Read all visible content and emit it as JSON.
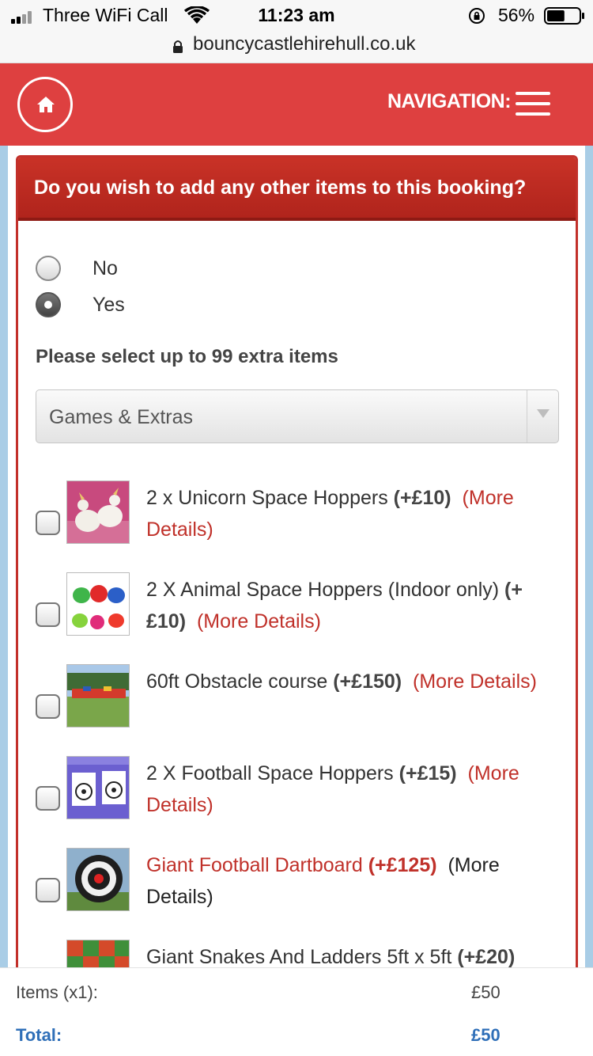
{
  "status_bar": {
    "carrier": "Three WiFi Call",
    "time": "11:23 am",
    "battery": "56%",
    "battery_level": 0.56,
    "icons": [
      "signal-icon",
      "wifi-icon",
      "orientation-lock-icon",
      "battery-icon"
    ]
  },
  "browser": {
    "url": "bouncycastlehirehull.co.uk"
  },
  "header": {
    "nav_label": "NAVIGATION:",
    "icons": [
      "home-icon",
      "hamburger-menu-icon"
    ],
    "color": "#de4040"
  },
  "panel": {
    "title": "Do you wish to add any other items to this booking?",
    "options": [
      {
        "label": "No",
        "selected": false
      },
      {
        "label": "Yes",
        "selected": true
      }
    ],
    "select_hint": "Please select up to 99 extra items",
    "category": "Games & Extras",
    "items": [
      {
        "name": "2 x Unicorn Space Hoppers",
        "price": "(+£10)",
        "more": "(More Details)",
        "checked": false,
        "highlighted": false
      },
      {
        "name": "2 X Animal Space Hoppers (Indoor only)",
        "price": "(+£10)",
        "more": "(More Details)",
        "checked": false,
        "highlighted": false
      },
      {
        "name": "60ft Obstacle course",
        "price": "(+£150)",
        "more": "(More Details)",
        "checked": false,
        "highlighted": false
      },
      {
        "name": "2 X Football Space Hoppers",
        "price": "(+£15)",
        "more": "(More Details)",
        "checked": false,
        "highlighted": false
      },
      {
        "name": "Giant Football Dartboard",
        "price": "(+£125)",
        "more": "(More Details)",
        "checked": false,
        "highlighted": true
      },
      {
        "name": "Giant Snakes And Ladders 5ft x 5ft",
        "price": "(+£20)",
        "more": "",
        "checked": false,
        "highlighted": false
      }
    ]
  },
  "summary": {
    "items_label": "Items (x1):",
    "items_value": "£50",
    "total_label": "Total:",
    "total_value": "£50"
  },
  "colors": {
    "brand_red": "#de4040",
    "panel_red": "#c2302a",
    "link_red": "#c0312a",
    "total_blue": "#2f6fb8",
    "stripe_blue": "#a9cde6"
  }
}
